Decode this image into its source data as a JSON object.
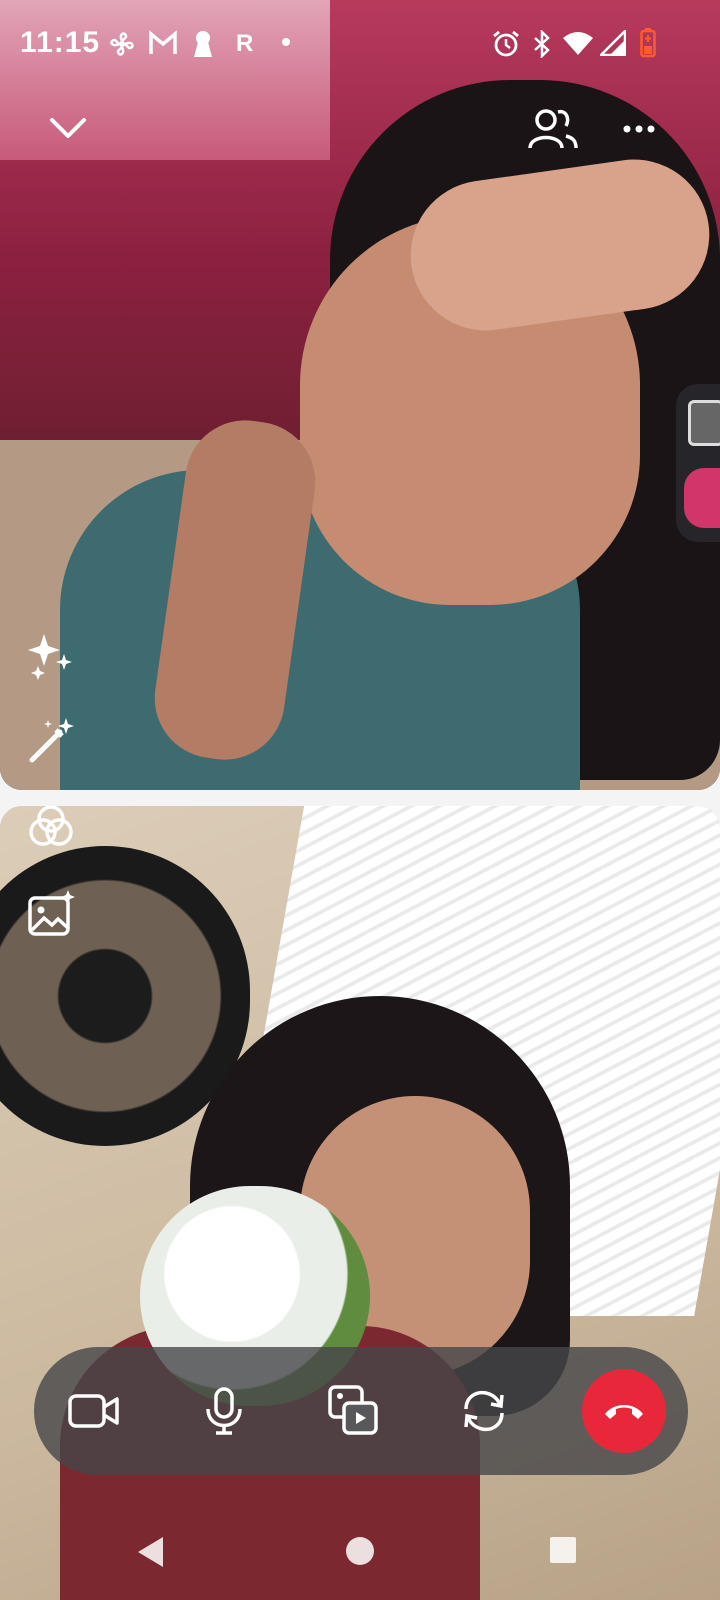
{
  "status_bar": {
    "time": "11:15",
    "left_icons": [
      "fan-icon",
      "gmail-icon",
      "keyhole-icon",
      "r-letter",
      "dot-icon"
    ],
    "r_letter": "R",
    "right_icons": [
      "alarm-icon",
      "bluetooth-icon",
      "wifi-icon",
      "signal-icon",
      "battery-icon"
    ],
    "battery_color": "#ff5a2a"
  },
  "top_bar": {
    "collapse_icon": "chevron-down-icon",
    "participants_icon": "participants-icon",
    "more_icon": "more-options-icon"
  },
  "remote_video": {
    "effects_icon": "sparkles-icon",
    "magic_icon": "magic-wand-icon"
  },
  "local_video": {
    "filters_icon": "filters-icon",
    "background_icon": "background-image-icon"
  },
  "call_controls": {
    "buttons": [
      "video-camera-icon",
      "microphone-icon",
      "media-share-icon",
      "switch-camera-icon"
    ],
    "end_call_icon": "end-call-icon",
    "end_call_color": "#e8283a"
  },
  "nav_bar": {
    "buttons": [
      "back-icon",
      "home-icon",
      "recents-icon"
    ]
  },
  "colors": {
    "accent": "#e8283a",
    "controls_bg": "#464648"
  }
}
